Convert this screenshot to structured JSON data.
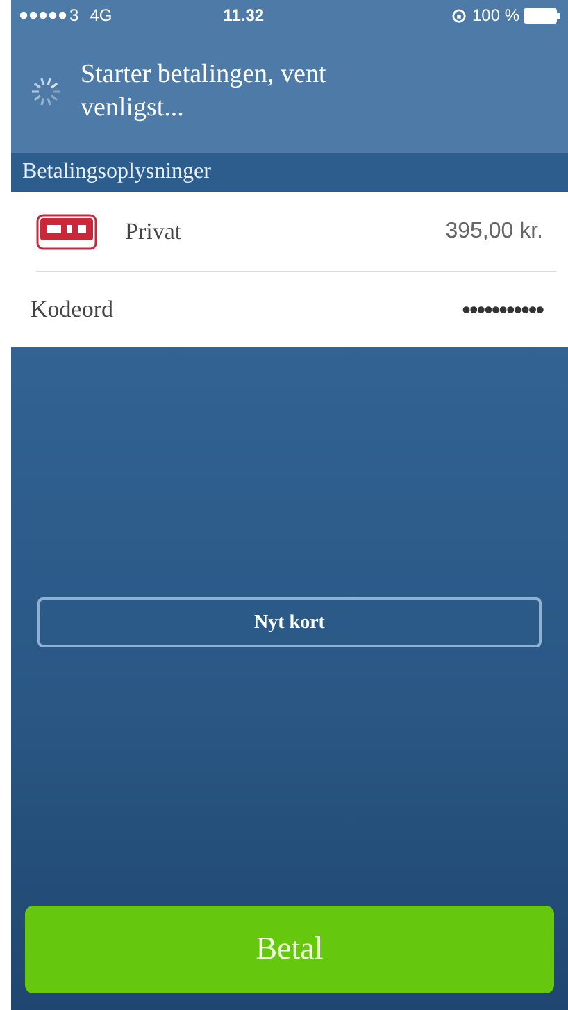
{
  "status_bar": {
    "carrier": "3",
    "network": "4G",
    "time": "11.32",
    "battery": "100 %"
  },
  "header": {
    "message": "Starter betalingen, vent venligst...",
    "loading": true
  },
  "section_title": "Betalingsoplysninger",
  "card": {
    "name": "Privat",
    "amount": "395,00 kr."
  },
  "password": {
    "label": "Kodeord",
    "value": "•••••••••••"
  },
  "new_card_button": "Nyt kort",
  "pay_button": "Betal"
}
